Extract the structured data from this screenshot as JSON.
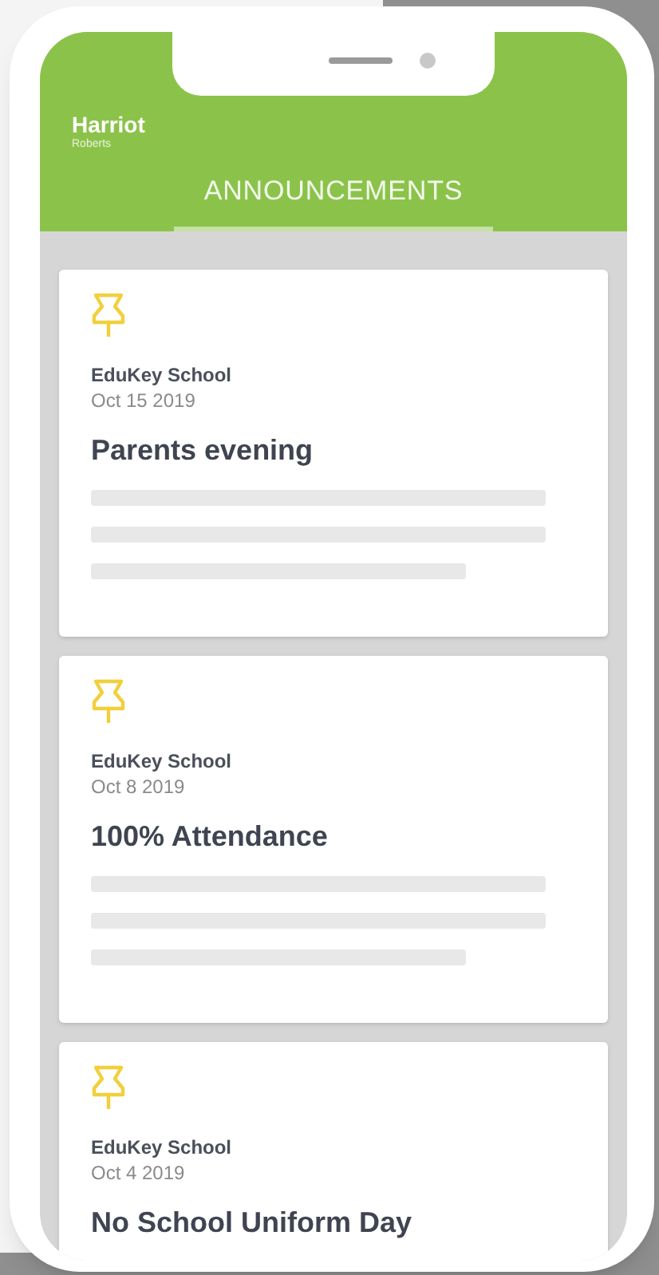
{
  "user": {
    "first_name": "Harriot",
    "last_name": "Roberts"
  },
  "tabs": [
    {
      "label": "ANNOUNCEMENTS",
      "selected": true
    }
  ],
  "announcements": [
    {
      "school": "EduKey School",
      "date": "Oct 15 2019",
      "title": "Parents evening"
    },
    {
      "school": "EduKey School",
      "date": "Oct 8 2019",
      "title": "100% Attendance"
    },
    {
      "school": "EduKey School",
      "date": "Oct 4 2019",
      "title": "No School Uniform Day"
    }
  ]
}
